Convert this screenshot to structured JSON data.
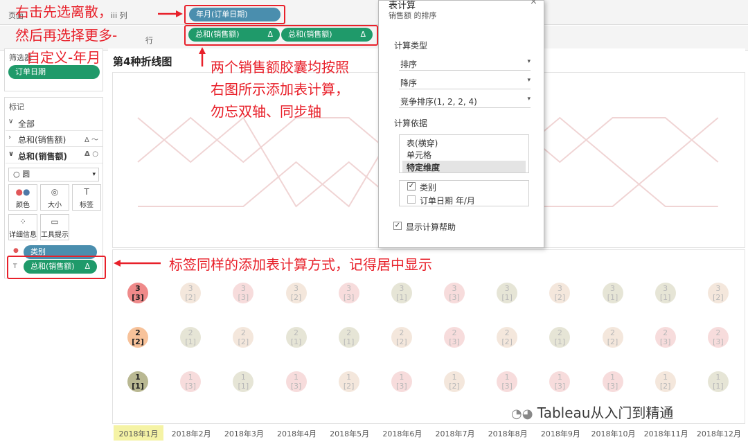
{
  "shelves": {
    "pages_label": "页面",
    "cols_label": "iii 列",
    "rows_label": "行",
    "col_pill": "年月(订单日期)",
    "row_pill_1": "总和(销售额)",
    "row_pill_2": "总和(销售额)",
    "delta": "Δ"
  },
  "filters": {
    "title": "筛选器",
    "pill": "订单日期"
  },
  "marks": {
    "title": "标记",
    "rows": [
      {
        "label": "全部",
        "chev": "∨",
        "icon": ""
      },
      {
        "label": "总和(销售额)",
        "chev": "›",
        "icon": "Δ ～"
      },
      {
        "label": "总和(销售额)",
        "chev": "∨",
        "icon": "Δ ○"
      }
    ],
    "marktype": "○ 圆",
    "buttons": {
      "color": "颜色",
      "size": "大小",
      "label": "标签",
      "detail": "详细信息",
      "tooltip": "工具提示"
    },
    "pill_category": "类别",
    "pill_sales": "总和(销售额)"
  },
  "sheet": {
    "title": "第4种折线图",
    "months": [
      "2018年1月",
      "2018年2月",
      "2018年3月",
      "2018年4月",
      "2018年5月",
      "2018年6月",
      "2018年7月",
      "2018年8月",
      "2018年9月",
      "2018年10月",
      "2018年11月",
      "2018年12月"
    ],
    "circle_rows": [
      {
        "num": [
          "3",
          "3",
          "3",
          "3",
          "3",
          "3",
          "3",
          "3",
          "3",
          "3",
          "3",
          "3"
        ],
        "rank": [
          "[3]",
          "[2]",
          "[3]",
          "[2]",
          "[3]",
          "[1]",
          "[3]",
          "[1]",
          "[2]",
          "[1]",
          "[1]",
          "[2]"
        ]
      },
      {
        "num": [
          "2",
          "2",
          "2",
          "2",
          "2",
          "2",
          "2",
          "2",
          "2",
          "2",
          "2",
          "2"
        ],
        "rank": [
          "[2]",
          "[1]",
          "[2]",
          "[1]",
          "[1]",
          "[2]",
          "[3]",
          "[2]",
          "[1]",
          "[2]",
          "[3]",
          "[3]"
        ]
      },
      {
        "num": [
          "1",
          "1",
          "1",
          "1",
          "1",
          "1",
          "1",
          "1",
          "1",
          "1",
          "1",
          "1"
        ],
        "rank": [
          "[1]",
          "[3]",
          "[1]",
          "[3]",
          "[2]",
          "[3]",
          "[2]",
          "[3]",
          "[3]",
          "[3]",
          "[2]",
          "[1]"
        ]
      }
    ]
  },
  "dialog": {
    "title": "表计算",
    "subtitle": "销售额 的排序",
    "calc_type_label": "计算类型",
    "calc_type": "排序",
    "order": "降序",
    "rank_style": "竞争排序(1, 2, 2, 4)",
    "compute_using_label": "计算依据",
    "compute_options": [
      "表(横穿)",
      "单元格",
      "特定维度"
    ],
    "dims": [
      "类别",
      "订单日期 年/月"
    ],
    "show_help": "显示计算帮助",
    "close": "×"
  },
  "annotations": {
    "top_left": [
      "右击先选离散，",
      "然后再选择更多-",
      "自定义-年月"
    ],
    "middle": [
      "两个销售额胶囊均按照",
      "右图所示添加表计算，",
      "勿忘双轴、同步轴"
    ],
    "bottom": "标签同样的添加表计算方式，记得居中显示"
  },
  "watermark": "Tableau从入门到精通",
  "colors": {
    "red": "#e8202a",
    "pill_blue": "#4a8eae",
    "pill_green": "#1f9a6a",
    "line": "#f0d4d4",
    "highlight": "#f5f3a5"
  }
}
